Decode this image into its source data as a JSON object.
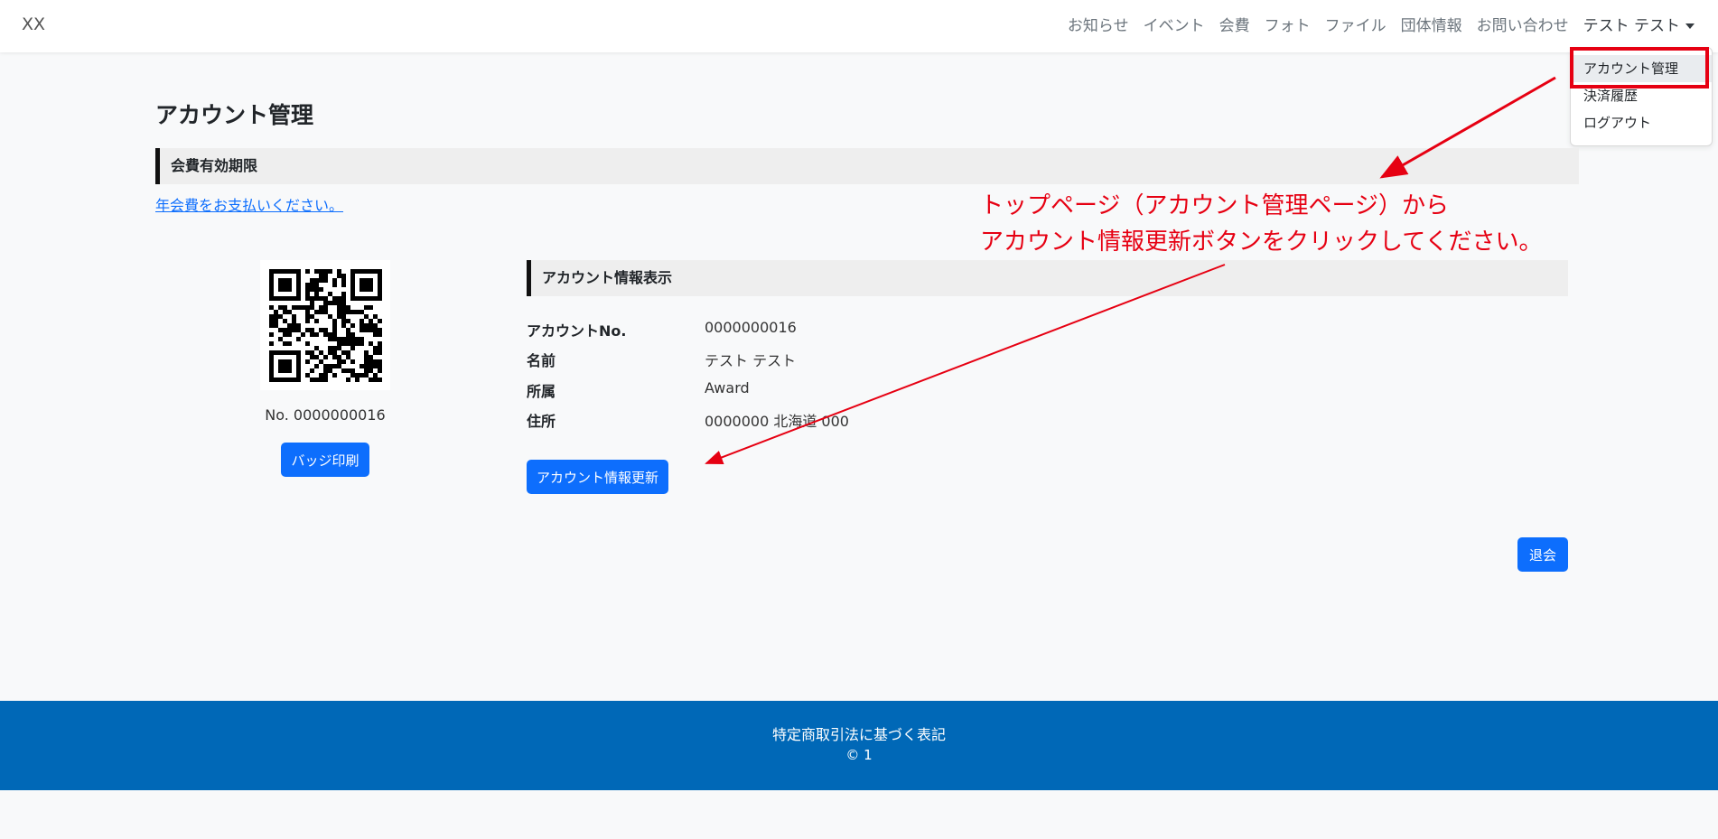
{
  "navbar": {
    "brand": "XX",
    "links": [
      "お知らせ",
      "イベント",
      "会費",
      "フォト",
      "ファイル",
      "団体情報",
      "お問い合わせ"
    ],
    "user": "テスト テスト"
  },
  "dropdown": {
    "items": [
      "アカウント管理",
      "決済履歴",
      "ログアウト"
    ],
    "active_index": 0
  },
  "page": {
    "title": "アカウント管理",
    "membership_section": "会費有効期限",
    "pay_link": "年会費をお支払いください。"
  },
  "badge": {
    "number_text": "No. 0000000016",
    "print_button": "バッジ印刷"
  },
  "account_info": {
    "section_title": "アカウント情報表示",
    "rows": [
      {
        "label": "アカウントNo.",
        "value": "0000000016"
      },
      {
        "label": "名前",
        "value": "テスト テスト"
      },
      {
        "label": "所属",
        "value": "Award"
      },
      {
        "label": "住所",
        "value": "0000000 北海道 000"
      }
    ],
    "update_button": "アカウント情報更新",
    "leave_button": "退会"
  },
  "footer": {
    "link": "特定商取引法に基づく表記",
    "copyright": "© 1"
  },
  "annotation": {
    "line1": "トップページ（アカウント管理ページ）から",
    "line2": "アカウント情報更新ボタンをクリックしてください。",
    "color": "#e60012"
  },
  "colors": {
    "primary": "#0d6efd",
    "footer": "#0068b7",
    "annotation": "#e60012"
  }
}
